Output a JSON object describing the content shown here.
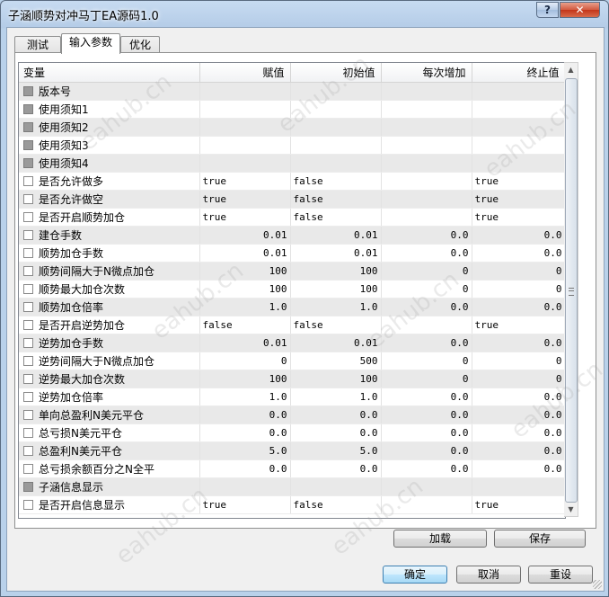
{
  "window": {
    "title": "子涵顺势对冲马丁EA源码1.0",
    "help_label": "?",
    "close_label": "✕"
  },
  "tabs": [
    {
      "label": "测试",
      "active": false
    },
    {
      "label": "输入参数",
      "active": true
    },
    {
      "label": "优化",
      "active": false
    }
  ],
  "grid": {
    "headers": {
      "variable": "变量",
      "value": "赋值",
      "start": "初始值",
      "step": "每次增加",
      "stop": "终止值"
    },
    "rows": [
      {
        "name": "版本号",
        "value": "",
        "start": "",
        "step": "",
        "stop": "",
        "gray": true,
        "checkbox": "disabled"
      },
      {
        "name": "使用须知1",
        "value": "",
        "start": "",
        "step": "",
        "stop": "",
        "gray": false,
        "checkbox": "disabled"
      },
      {
        "name": "使用须知2",
        "value": "",
        "start": "",
        "step": "",
        "stop": "",
        "gray": true,
        "checkbox": "disabled"
      },
      {
        "name": "使用须知3",
        "value": "",
        "start": "",
        "step": "",
        "stop": "",
        "gray": false,
        "checkbox": "disabled"
      },
      {
        "name": "使用须知4",
        "value": "",
        "start": "",
        "step": "",
        "stop": "",
        "gray": true,
        "checkbox": "disabled"
      },
      {
        "name": "是否允许做多",
        "value": "true",
        "start": "false",
        "step": "",
        "stop": "true",
        "gray": false,
        "checkbox": "unchecked",
        "kind": "text"
      },
      {
        "name": "是否允许做空",
        "value": "true",
        "start": "false",
        "step": "",
        "stop": "true",
        "gray": true,
        "checkbox": "unchecked",
        "kind": "text"
      },
      {
        "name": "是否开启顺势加仓",
        "value": "true",
        "start": "false",
        "step": "",
        "stop": "true",
        "gray": false,
        "checkbox": "unchecked",
        "kind": "text"
      },
      {
        "name": "建仓手数",
        "value": "0.01",
        "start": "0.01",
        "step": "0.0",
        "stop": "0.0",
        "gray": true,
        "checkbox": "unchecked",
        "kind": "num"
      },
      {
        "name": "顺势加仓手数",
        "value": "0.01",
        "start": "0.01",
        "step": "0.0",
        "stop": "0.0",
        "gray": false,
        "checkbox": "unchecked",
        "kind": "num"
      },
      {
        "name": "顺势间隔大于N微点加仓",
        "value": "100",
        "start": "100",
        "step": "0",
        "stop": "0",
        "gray": true,
        "checkbox": "unchecked",
        "kind": "num"
      },
      {
        "name": "顺势最大加仓次数",
        "value": "100",
        "start": "100",
        "step": "0",
        "stop": "0",
        "gray": false,
        "checkbox": "unchecked",
        "kind": "num"
      },
      {
        "name": "顺势加仓倍率",
        "value": "1.0",
        "start": "1.0",
        "step": "0.0",
        "stop": "0.0",
        "gray": true,
        "checkbox": "unchecked",
        "kind": "num"
      },
      {
        "name": "是否开启逆势加仓",
        "value": "false",
        "start": "false",
        "step": "",
        "stop": "true",
        "gray": false,
        "checkbox": "unchecked",
        "kind": "text"
      },
      {
        "name": "逆势加仓手数",
        "value": "0.01",
        "start": "0.01",
        "step": "0.0",
        "stop": "0.0",
        "gray": true,
        "checkbox": "unchecked",
        "kind": "num"
      },
      {
        "name": "逆势间隔大于N微点加仓",
        "value": "0",
        "start": "500",
        "step": "0",
        "stop": "0",
        "gray": false,
        "checkbox": "unchecked",
        "kind": "num"
      },
      {
        "name": "逆势最大加仓次数",
        "value": "100",
        "start": "100",
        "step": "0",
        "stop": "0",
        "gray": true,
        "checkbox": "unchecked",
        "kind": "num"
      },
      {
        "name": "逆势加仓倍率",
        "value": "1.0",
        "start": "1.0",
        "step": "0.0",
        "stop": "0.0",
        "gray": false,
        "checkbox": "unchecked",
        "kind": "num"
      },
      {
        "name": "单向总盈利N美元平仓",
        "value": "0.0",
        "start": "0.0",
        "step": "0.0",
        "stop": "0.0",
        "gray": true,
        "checkbox": "unchecked",
        "kind": "num"
      },
      {
        "name": "总亏损N美元平仓",
        "value": "0.0",
        "start": "0.0",
        "step": "0.0",
        "stop": "0.0",
        "gray": false,
        "checkbox": "unchecked",
        "kind": "num"
      },
      {
        "name": "总盈利N美元平仓",
        "value": "5.0",
        "start": "5.0",
        "step": "0.0",
        "stop": "0.0",
        "gray": true,
        "checkbox": "unchecked",
        "kind": "num"
      },
      {
        "name": "总亏损余额百分之N全平",
        "value": "0.0",
        "start": "0.0",
        "step": "0.0",
        "stop": "0.0",
        "gray": false,
        "checkbox": "unchecked",
        "kind": "num"
      },
      {
        "name": "子涵信息显示",
        "value": "",
        "start": "",
        "step": "",
        "stop": "",
        "gray": true,
        "checkbox": "disabled"
      },
      {
        "name": "是否开启信息显示",
        "value": "true",
        "start": "false",
        "step": "",
        "stop": "true",
        "gray": false,
        "checkbox": "unchecked",
        "kind": "text"
      }
    ]
  },
  "buttons": {
    "load": "加载",
    "save": "保存",
    "ok": "确定",
    "cancel": "取消",
    "reset": "重设"
  },
  "watermark": "eahub.cn"
}
